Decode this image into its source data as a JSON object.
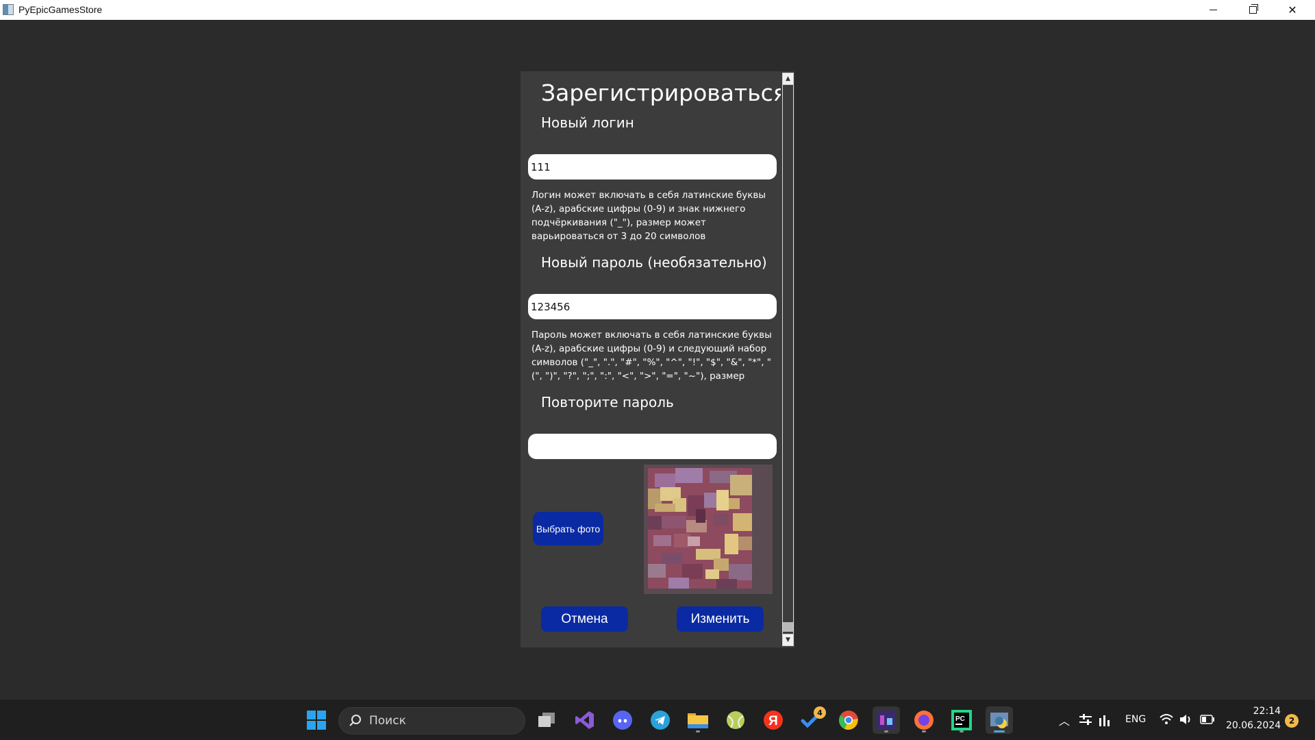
{
  "window": {
    "title": "PyEpicGamesStore"
  },
  "dialog": {
    "title": "Зарегистрироваться",
    "login": {
      "label": "Новый логин",
      "value": "111",
      "hint": "Логин может включать в себя латинские буквы (A-z), арабские цифры (0-9) и знак нижнего подчёркивания (\"_\"), размер может варьироваться от 3 до 20 символов"
    },
    "password": {
      "label": "Новый пароль (необязательно)",
      "value": "123456",
      "hint": "Пароль может включать в себя латинские буквы (A-z), арабские цифры (0-9) и следующий набор символов (\"_\", \".\", \"#\", \"%\", \"^\", \"!\", \"$\", \"&\", \"*\", \"(\", \")\", \"?\", \";\", \":\", \"<\", \">\", \"=\", \"~\"), размер может"
    },
    "repeat": {
      "label": "Повторите пароль",
      "value": ""
    },
    "choose_photo_label": "Выбрать фото",
    "cancel_label": "Отмена",
    "confirm_label": "Изменить"
  },
  "taskbar": {
    "search_placeholder": "Поиск",
    "badge_count": "4",
    "language": "ENG",
    "time": "22:14",
    "date": "20.06.2024",
    "notifications": "2"
  },
  "icons": {
    "start": "windows-start-icon",
    "task_view": "task-view-icon",
    "visual_studio": "visual-studio-icon",
    "discord": "discord-icon",
    "telegram": "telegram-icon",
    "explorer": "file-explorer-icon",
    "tennis": "tennis-ball-icon",
    "yandex": "yandex-icon",
    "todo": "todo-icon",
    "chrome": "chrome-icon",
    "game": "game-icon",
    "firefox": "firefox-icon",
    "pycharm": "pycharm-icon",
    "python": "python-app-icon"
  },
  "colors": {
    "background": "#2b2b2b",
    "panel": "#3c3c3c",
    "button": "#0a2aa3",
    "input": "#ffffff"
  }
}
